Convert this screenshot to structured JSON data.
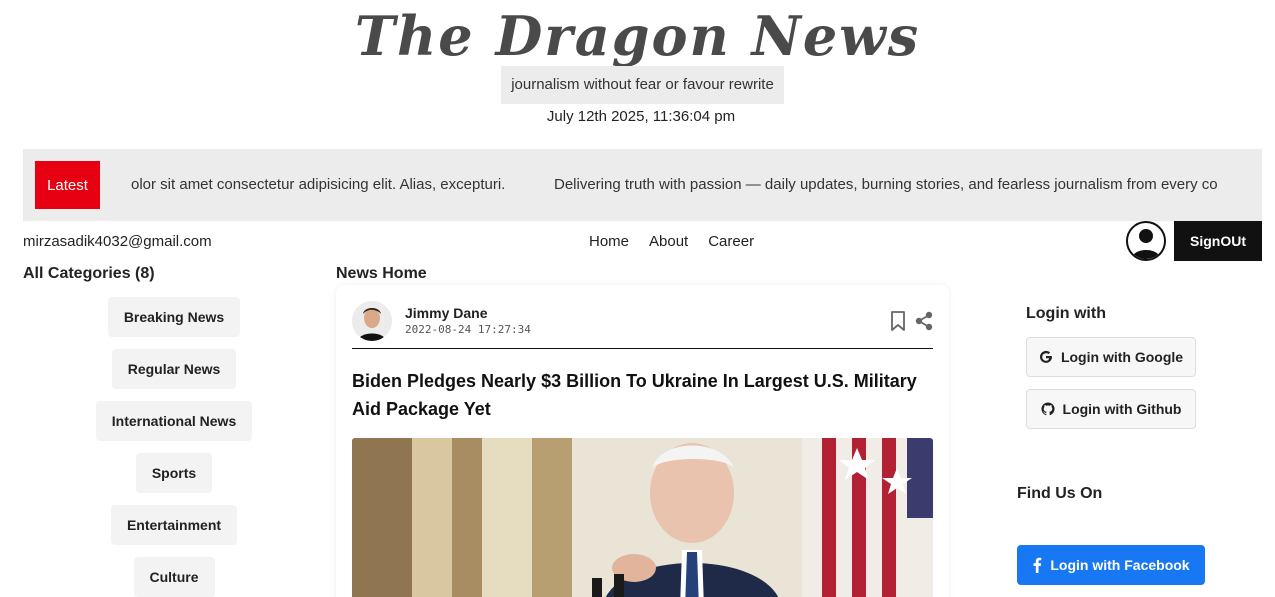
{
  "masthead": {
    "brand": "The Dragon News",
    "tagline": "journalism without fear or favour rewrite",
    "datetime": "July 12th 2025, 11:36:04 pm"
  },
  "ticker": {
    "badge": "Latest",
    "item1": "olor sit amet consectetur adipisicing elit. Alias, excepturi.",
    "item2": "Delivering truth with passion — daily updates, burning stories, and fearless journalism from every co"
  },
  "navbar": {
    "email": "mirzasadik4032@gmail.com",
    "links": [
      "Home",
      "About",
      "Career"
    ],
    "signout": "SignOUt"
  },
  "categories": {
    "title": "All Categories (8)",
    "items": [
      "Breaking News",
      "Regular News",
      "International News",
      "Sports",
      "Entertainment",
      "Culture"
    ]
  },
  "main": {
    "section_title": "News Home",
    "article": {
      "author": "Jimmy Dane",
      "published": "2022-08-24 17:27:34",
      "headline": "Biden Pledges Nearly $3 Billion To Ukraine In Largest U.S. Military Aid Package Yet"
    }
  },
  "sidebar": {
    "login_title": "Login with",
    "google_label": "Login with Google",
    "github_label": "Login with Github",
    "find_title": "Find Us On",
    "facebook_label": "Login with Facebook"
  },
  "colors": {
    "accent_red": "#e60012",
    "facebook_blue": "#1877f2",
    "dark": "#111111"
  }
}
